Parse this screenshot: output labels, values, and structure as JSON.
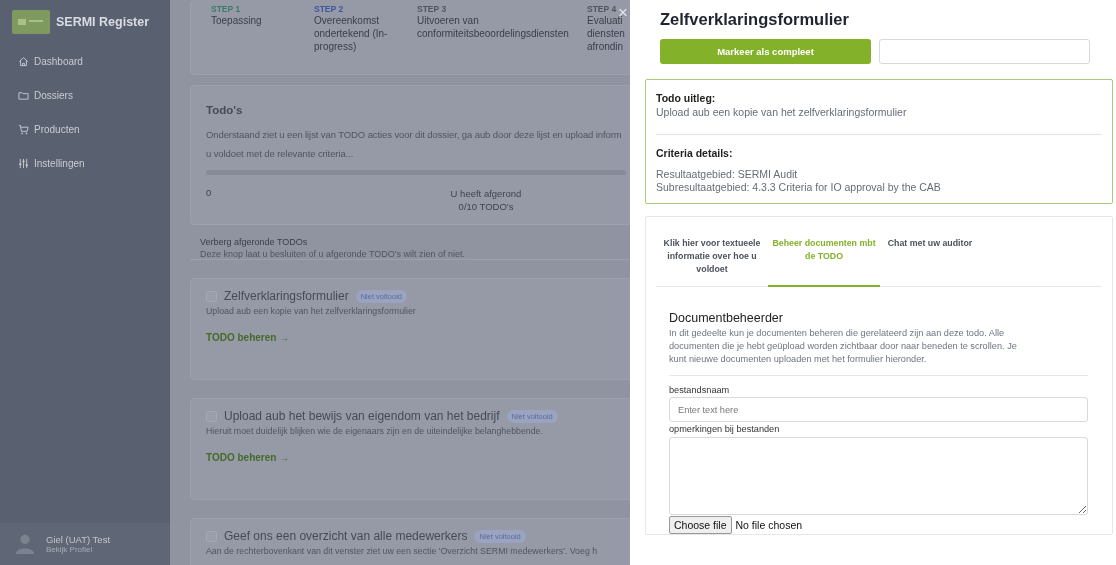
{
  "sidebar": {
    "brand": "SERMI Register",
    "items": [
      {
        "label": "Dashboard"
      },
      {
        "label": "Dossiers"
      },
      {
        "label": "Producten"
      },
      {
        "label": "Instellingen"
      }
    ],
    "user": {
      "name": "Giel (UAT) Test",
      "link": "Bekijk Profiel"
    }
  },
  "steps": [
    {
      "step": "STEP 1",
      "label": "Toepassing",
      "color": "#3f7a68"
    },
    {
      "step": "STEP 2",
      "label": "Overeenkomst ondertekend (In-progress)",
      "color": "#3f55a0"
    },
    {
      "step": "STEP 3",
      "label": "Uitvoeren van conformiteitsbeoordelingsdiensten",
      "color": "#4f5562"
    },
    {
      "step": "STEP 4",
      "label": "Evaluati diensten afrondin",
      "color": "#4f5562"
    }
  ],
  "todos": {
    "title": "Todo's",
    "description_lines": [
      "Onderstaand ziet u een lijst van TODO acties voor dit dossier, ga aub door deze lijst en upload inform",
      "u voldoet met de relevante criteria..."
    ],
    "level": 0,
    "count": "0",
    "summary": "U heeft afgerond 0/10 TODO's"
  },
  "hide_completed": {
    "title": "Verberg afgeronde TODOs",
    "description": "Deze knop laat u besluiten of u afgeronde TODO's wilt zien of niet."
  },
  "items": [
    {
      "title": "Zelfverklaringsformulier",
      "badge": "Niet voltooid",
      "description": "Upload aub een kopie van het zelfverklaringsformulier",
      "link": "TODO beheren →",
      "checked": false
    },
    {
      "title": "Upload aub het bewijs van eigendom van het bedrijf",
      "badge": "Niet voltooid",
      "description": "Hieruit moet duidelijk blijken wie de eigenaars zijn en de uiteindelijke belanghebbende.",
      "link": "TODO beheren →",
      "checked": false
    },
    {
      "title": "Geef ons een overzicht van alle medewerkers",
      "badge": "Niet voltooid",
      "description": "Aan de rechterbovenkant van dit venster ziet uw een sectie 'Overzicht SERMI medewerkers'. Voeg h",
      "checked": false
    }
  ],
  "close": "×",
  "panel": {
    "title": "Zelfverklaringsformulier",
    "complete_button": "Markeer als compleet"
  },
  "info": {
    "todo_heading": "Todo uitleg:",
    "todo_text": "Upload aub een kopie van het zelfverklaringsformulier",
    "criteria_heading": "Criteria details:",
    "criteria_lines": [
      "Resultaatgebied: SERMI Audit",
      "Subresultaatgebied: 4.3.3 Criteria for IO approval by the CAB"
    ]
  },
  "tabs": [
    {
      "label": "Klik hier voor textueele informatie over hoe u voldoet",
      "selected": false
    },
    {
      "label": "Beheer documenten mbt de TODO",
      "selected": true
    },
    {
      "label": "Chat met uw auditor",
      "selected": false
    }
  ],
  "documents": {
    "title": "Documentbeheerder",
    "description": "In dit gedeelte kun je documenten beheren die gerelateerd zijn aan deze todo. Alle documenten die je hebt geüpload worden zichtbaar door naar beneden te scrollen. Je kunt nieuwe documenten uploaden met het formulier hieronder.",
    "filename_label": "bestandsnaam",
    "filename_placeholder": "Enter text here",
    "remarks_label": "opmerkingen bij bestanden",
    "file_button": "Choose file",
    "file_status": "No file chosen"
  }
}
